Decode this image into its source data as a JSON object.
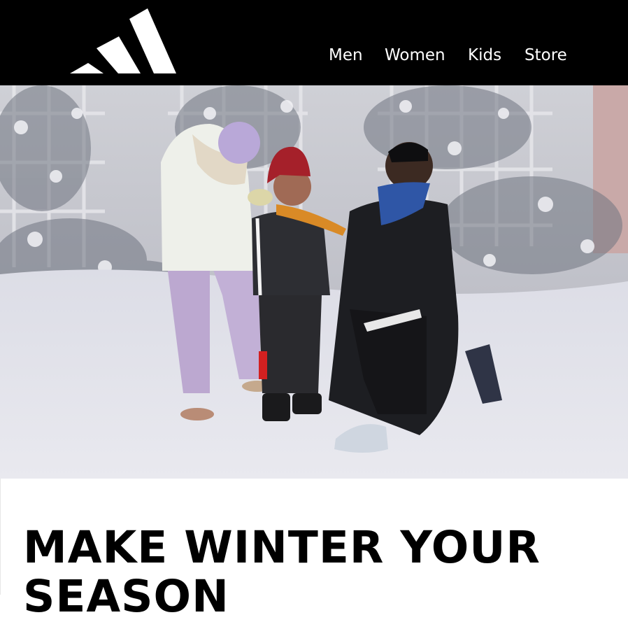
{
  "header": {
    "logo_icon": "adidas-three-stripes-logo",
    "nav": [
      {
        "label": "Men"
      },
      {
        "label": "Women"
      },
      {
        "label": "Kids"
      },
      {
        "label": "Store"
      }
    ]
  },
  "hero": {
    "image": "family-in-snowy-garden-photo"
  },
  "main": {
    "headline": "MAKE WINTER YOUR SEASON"
  },
  "colors": {
    "header_bg": "#000000",
    "nav_text": "#ffffff",
    "headline_text": "#000000"
  }
}
